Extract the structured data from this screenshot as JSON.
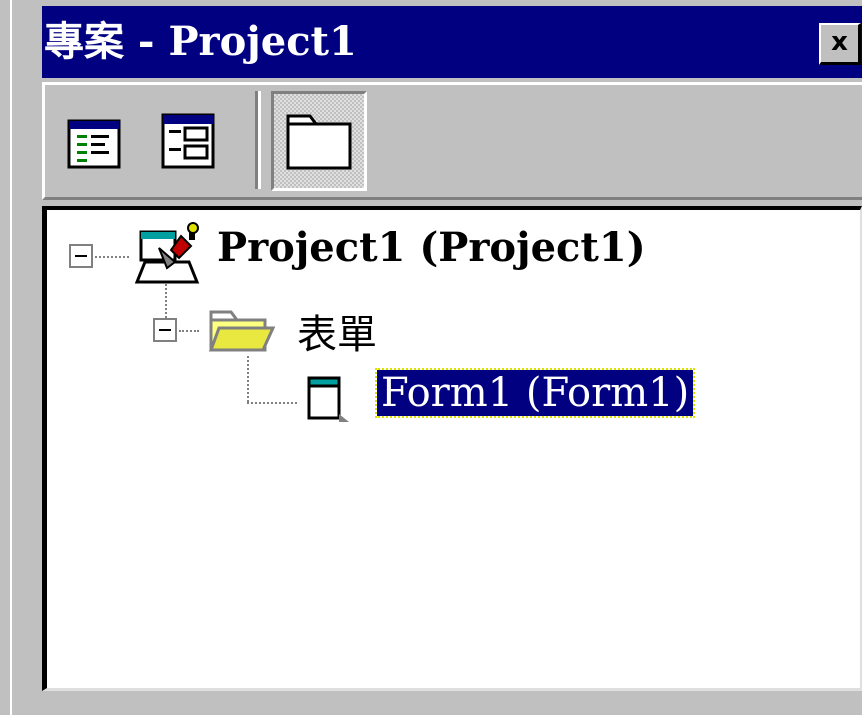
{
  "window": {
    "title": "專案 - Project1",
    "close_label": "x"
  },
  "toolbar": {
    "buttons": [
      {
        "name": "view-code",
        "icon": "view-code-icon"
      },
      {
        "name": "view-object",
        "icon": "view-object-icon"
      },
      {
        "name": "toggle-folders",
        "icon": "folder-icon",
        "pressed": true
      }
    ]
  },
  "tree": {
    "project": {
      "label": "Project1 (Project1)",
      "icon": "project-icon",
      "expanded": true
    },
    "forms_folder": {
      "label": "表單",
      "icon": "folder-open-icon",
      "expanded": true
    },
    "form": {
      "label": "Form1 (Form1)",
      "icon": "form-icon",
      "selected": true
    }
  },
  "colors": {
    "titlebar": "#000080",
    "face": "#c0c0c0",
    "selection": "#000080"
  }
}
